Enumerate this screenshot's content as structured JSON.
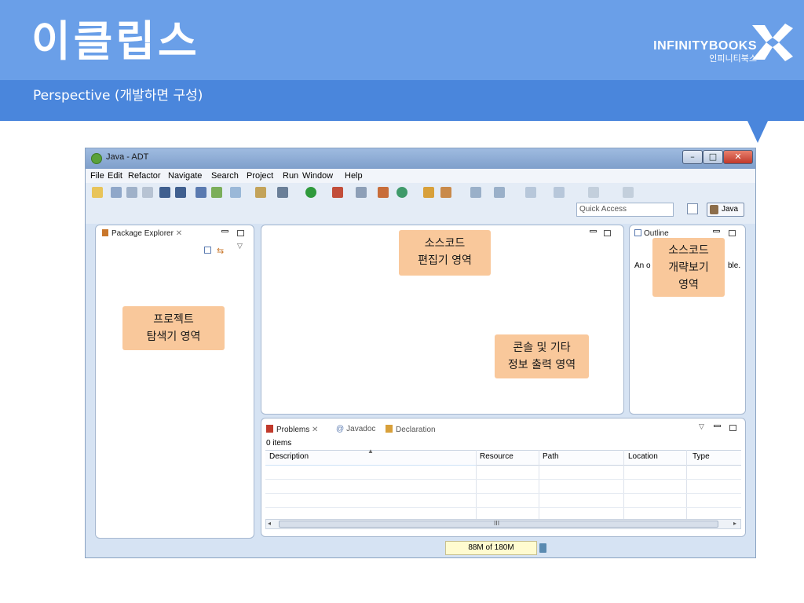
{
  "slide": {
    "title": "이클립스",
    "subtitle": "Perspective (개발하면 구성)",
    "brand_en": "INFINITYBOOKS",
    "brand_ko": "인피니티북스"
  },
  "window": {
    "title": "Java - ADT",
    "menu": [
      "File",
      "Edit",
      "Refactor",
      "Navigate",
      "Search",
      "Project",
      "Run",
      "Window",
      "Help"
    ],
    "quick_access": "Quick Access",
    "perspective_label": "Java"
  },
  "package_explorer": {
    "tab_label": "Package Explorer",
    "callout_line1": "프로젝트",
    "callout_line2": "탐색기 영역"
  },
  "editor": {
    "callout_line1": "소스코드",
    "callout_line2": "편집기 영역"
  },
  "outline": {
    "tab_label": "Outline",
    "body_text": "An o",
    "body_text_end": "ble.",
    "callout_line1": "소스코드",
    "callout_line2": "개략보기",
    "callout_line3": "영역"
  },
  "console_callout": {
    "line1": "콘솔 및 기타",
    "line2": "정보 출력 영역"
  },
  "bottom_panel": {
    "tabs": [
      "Problems",
      "Javadoc",
      "Declaration"
    ],
    "item_count": "0 items",
    "columns": [
      "Description",
      "Resource",
      "Path",
      "Location",
      "Type"
    ],
    "scroll_mark": "III"
  },
  "status": {
    "heap": "88M of 180M"
  },
  "colors": {
    "header": "#6a9fe8",
    "band": "#4a86dc",
    "callout": "#f9c89b"
  }
}
